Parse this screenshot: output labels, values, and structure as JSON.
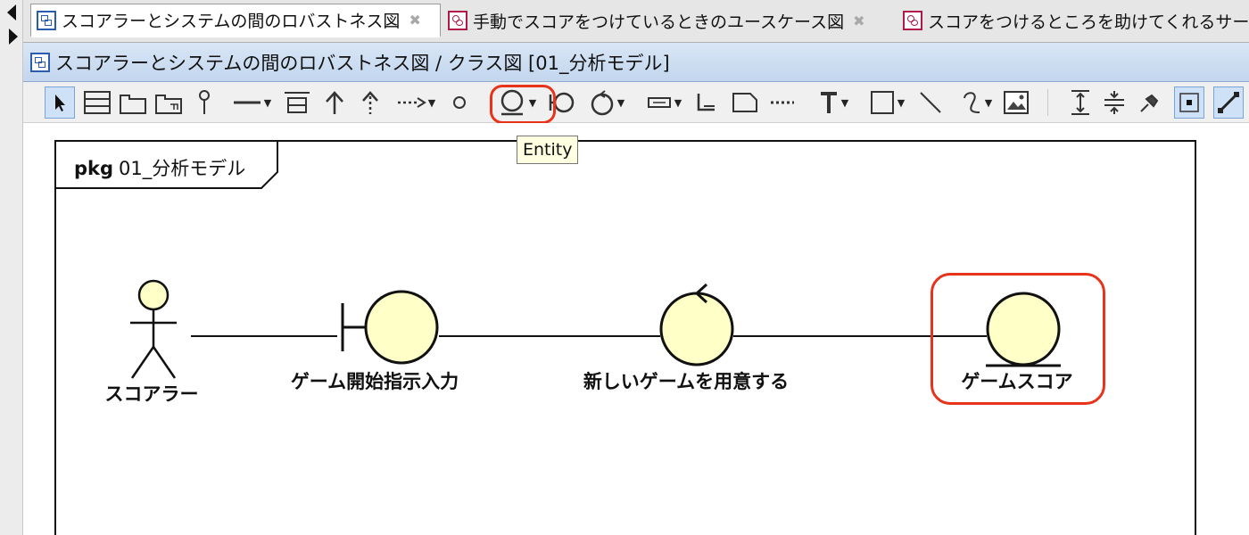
{
  "tabs": [
    {
      "title": "スコアラーとシステムの間のロバストネス図",
      "icon": "class-diagram-icon",
      "active": true
    },
    {
      "title": "手動でスコアをつけているときのユースケース図",
      "icon": "usecase-diagram-icon",
      "active": false
    },
    {
      "title": "スコアをつけるところを助けてくれるサービ",
      "icon": "usecase-diagram-icon",
      "active": false
    }
  ],
  "title_bar": {
    "text": "スコアラーとシステムの間のロバストネス図 / クラス図 [01_分析モデル]"
  },
  "toolbar": {
    "tools": [
      "select",
      "class",
      "package",
      "subsystem",
      "interface",
      "association",
      "aggregation",
      "generalization",
      "realization",
      "dependency",
      "usecase",
      "entity",
      "boundary",
      "control",
      "attribute",
      "constraint",
      "note",
      "note-anchor",
      "text",
      "rectangle",
      "line",
      "freehand",
      "image",
      "distribute-vertical",
      "distribute-horizontal",
      "pin",
      "snap",
      "auto-route"
    ],
    "selected": "select",
    "highlighted": "entity"
  },
  "tooltip": {
    "text": "Entity"
  },
  "frame": {
    "keyword": "pkg",
    "name": "01_分析モデル"
  },
  "elements": {
    "actor": {
      "label": "スコアラー"
    },
    "boundary": {
      "label": "ゲーム開始指示入力"
    },
    "control": {
      "label": "新しいゲームを用意する"
    },
    "entity": {
      "label": "ゲームスコア"
    }
  },
  "colors": {
    "element_fill": "#ffffc8",
    "highlight": "#e8331b",
    "title_bar": "#c8dbf0",
    "tooltip_bg": "#ffffe1"
  }
}
